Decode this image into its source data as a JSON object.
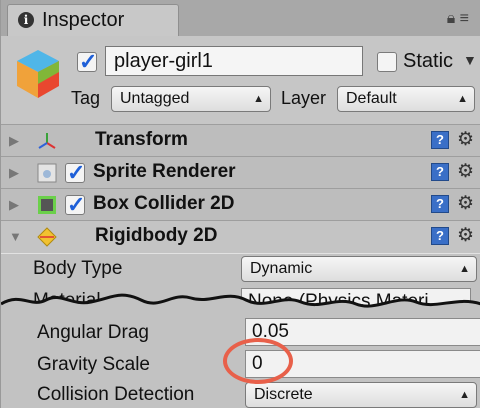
{
  "tab": {
    "title": "Inspector"
  },
  "gameobject": {
    "name": "player-girl1",
    "static_label": "Static",
    "tag_label": "Tag",
    "tag_value": "Untagged",
    "layer_label": "Layer",
    "layer_value": "Default"
  },
  "components": [
    {
      "name": "Transform"
    },
    {
      "name": "Sprite Renderer"
    },
    {
      "name": "Box Collider 2D"
    },
    {
      "name": "Rigidbody 2D"
    }
  ],
  "rigidbody": {
    "body_type_label": "Body Type",
    "body_type_value": "Dynamic",
    "material_label": "Material",
    "material_value": "None (Physics Materi",
    "angular_drag_label": "Angular Drag",
    "angular_drag_value": "0.05",
    "gravity_scale_label": "Gravity Scale",
    "gravity_scale_value": "0",
    "collision_detection_label": "Collision Detection",
    "collision_detection_value": "Discrete"
  },
  "colors": {
    "highlight_circle": "#e8604a",
    "checkbox_tick": "#1e5fd8",
    "help_icon": "#3a6fc7"
  }
}
